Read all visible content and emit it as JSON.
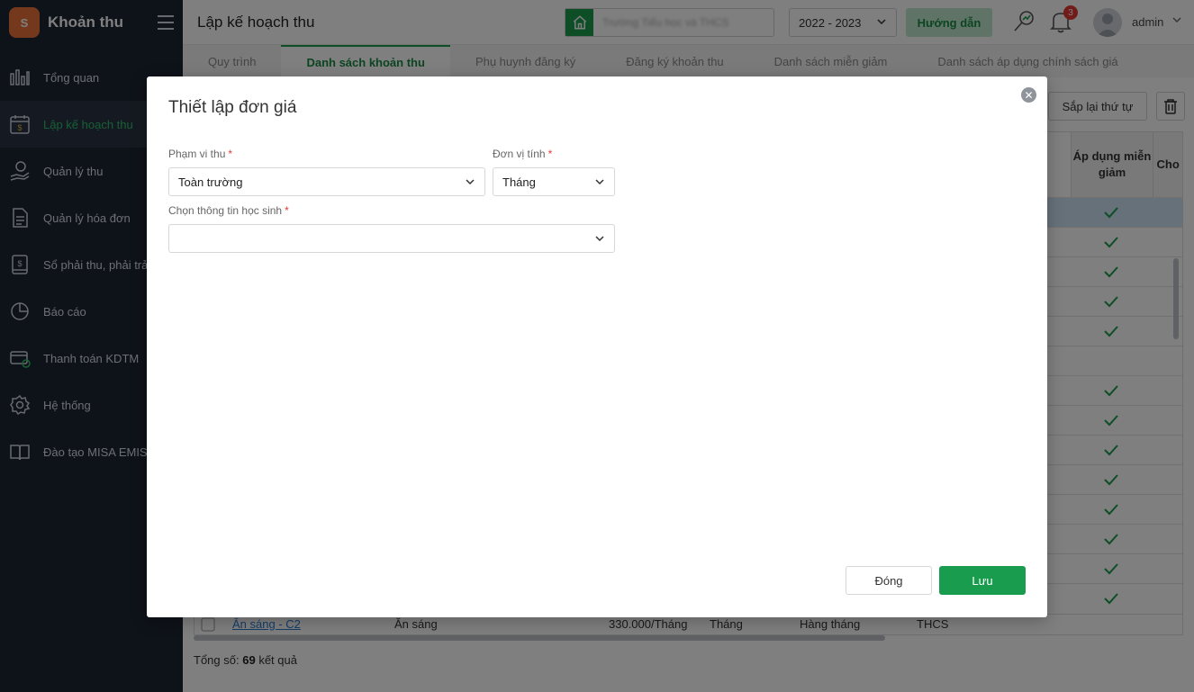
{
  "app": {
    "brand_title": "Khoản thu",
    "logo_text": "S"
  },
  "sidebar": {
    "items": [
      {
        "label": "Tổng quan",
        "icon": "bar-chart-icon"
      },
      {
        "label": "Lập kế hoạch thu",
        "icon": "calendar-money-icon",
        "active": true
      },
      {
        "label": "Quản lý thu",
        "icon": "hand-coin-icon"
      },
      {
        "label": "Quản lý hóa đơn",
        "icon": "invoice-icon"
      },
      {
        "label": "Sổ phải thu, phải trả",
        "icon": "ledger-icon"
      },
      {
        "label": "Báo cáo",
        "icon": "pie-chart-icon"
      },
      {
        "label": "Thanh toán KDTM",
        "icon": "card-payment-icon"
      },
      {
        "label": "Hệ thống",
        "icon": "gear-icon"
      },
      {
        "label": "Đào tạo MISA EMIS",
        "icon": "book-icon"
      }
    ]
  },
  "header": {
    "page_title": "Lập kế hoạch thu",
    "school_name": "Trường Tiểu học và THCS",
    "year": "2022 - 2023",
    "guide_label": "Hướng dẫn",
    "notification_count": "3",
    "user": "admin"
  },
  "tabs": [
    {
      "label": "Quy trình"
    },
    {
      "label": "Danh sách khoản thu",
      "active": true
    },
    {
      "label": "Phụ huynh đăng ký"
    },
    {
      "label": "Đăng ký khoản thu"
    },
    {
      "label": "Danh sách miễn giảm"
    },
    {
      "label": "Danh sách áp dụng chính sách giá"
    }
  ],
  "toolbar": {
    "reorder_label": "Sắp lại thứ tự"
  },
  "grid": {
    "col_apply_discount": "Áp dụng miễn giảm",
    "col_allow_invoice": "Cho hóa",
    "checks": [
      true,
      true,
      true,
      true,
      true,
      false,
      true,
      true,
      true,
      true,
      true,
      true,
      true,
      true
    ],
    "last_row": {
      "name": "Ăn sáng - C2",
      "type": "Ăn sáng",
      "price": "330.000/Tháng",
      "unit": "Tháng",
      "period": "Hàng tháng",
      "level": "THCS"
    },
    "total_prefix": "Tổng số:",
    "total_count": "69",
    "total_suffix": "kết quả"
  },
  "modal": {
    "title": "Thiết lập đơn giá",
    "scope_label": "Phạm vi thu",
    "scope_value": "Toàn trường",
    "unit_label": "Đơn vị tính",
    "unit_value": "Tháng",
    "student_label": "Chọn thông tin học sinh",
    "student_value": "",
    "required_mark": "*",
    "close_label": "Đóng",
    "save_label": "Lưu"
  },
  "colors": {
    "sidebar_bg": "#1d2533",
    "accent_green": "#1a9c4e",
    "active_text": "#2fbf6a",
    "required_red": "#e53935"
  }
}
